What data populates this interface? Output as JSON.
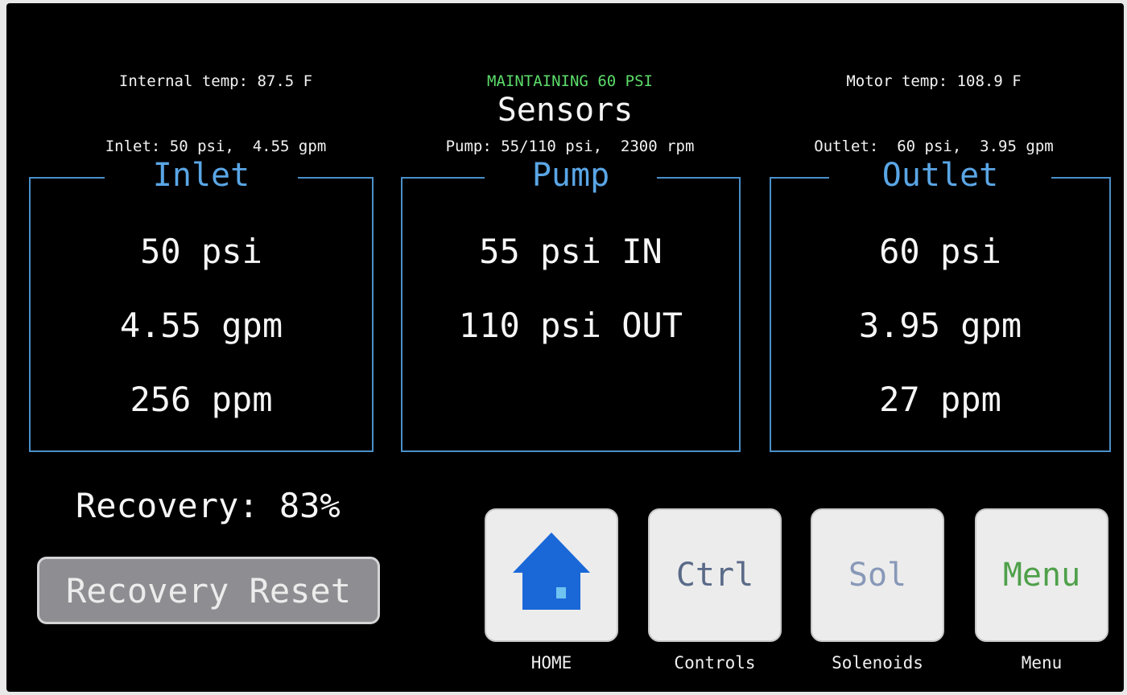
{
  "status": {
    "left_line1": "Internal temp: 87.5 F",
    "left_line2": "Inlet: 50 psi,  4.55 gpm",
    "center_line1": "MAINTAINING 60 PSI",
    "center_line2": "Pump: 55/110 psi,  2300 rpm",
    "right_line1": "Motor temp: 108.9 F",
    "right_line2": "Outlet:  60 psi,  3.95 gpm"
  },
  "screen_title": "Sensors",
  "panels": {
    "inlet": {
      "title": "Inlet",
      "pressure": "50 psi",
      "flow": "4.55 gpm",
      "tds": "256 ppm"
    },
    "pump": {
      "title": "Pump",
      "pressure_in": "55 psi IN",
      "pressure_out": "110 psi OUT"
    },
    "outlet": {
      "title": "Outlet",
      "pressure": "60 psi",
      "flow": "3.95 gpm",
      "tds": "27 ppm"
    }
  },
  "recovery": {
    "label": "Recovery: 83%",
    "reset_label": "Recovery Reset"
  },
  "nav": {
    "home": {
      "icon": "home-icon",
      "label": "HOME"
    },
    "controls": {
      "text": "Ctrl",
      "label": "Controls",
      "color": "#5a6a88"
    },
    "solenoids": {
      "text": "Sol",
      "label": "Solenoids",
      "color": "#8898b8"
    },
    "menu": {
      "text": "Menu",
      "label": "Menu",
      "color": "#4fa04a"
    }
  },
  "colors": {
    "background": "#000000",
    "accent_blue": "#5aa6e6",
    "panel_border": "#4a8fc8",
    "status_green": "#5cdc6a",
    "home_icon": "#1a68d8"
  }
}
